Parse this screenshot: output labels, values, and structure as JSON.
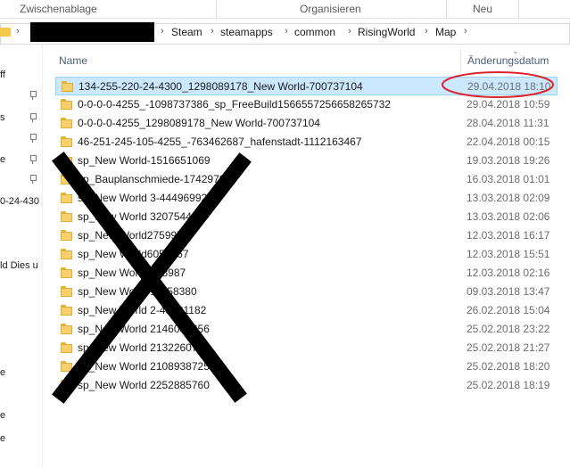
{
  "ribbon": {
    "groups": [
      "Zwischenablage",
      "Organisieren",
      "Neu"
    ]
  },
  "address": {
    "path": [
      "Steam",
      "steamapps",
      "common",
      "RisingWorld",
      "Map"
    ]
  },
  "nav": {
    "fragments": [
      "ff",
      "s",
      "e",
      "0-24-430",
      "ld Dies u",
      "e",
      "e",
      "e"
    ]
  },
  "columns": {
    "name": "Name",
    "date": "Änderungsdatum"
  },
  "files": [
    {
      "name": "134-255-220-24-4300_1298089178_New World-700737104",
      "date": "29.04.2018 18:10"
    },
    {
      "name": "0-0-0-0-4255_-1098737386_sp_FreeBuild1566557256658265732",
      "date": "29.04.2018 10:59"
    },
    {
      "name": "0-0-0-0-4255_1298089178_New World-700737104",
      "date": "28.04.2018 11:31"
    },
    {
      "name": "46-251-245-105-4255_-763462687_hafenstadt-1112163467",
      "date": "22.04.2018 00:15"
    },
    {
      "name": "sp_New World-1516651069",
      "date": "19.03.2018 19:26"
    },
    {
      "name": "sp_Bauplanschmiede-1742978",
      "date": "16.03.2018 01:01"
    },
    {
      "name": "sp_New World 3-44496992",
      "date": "13.03.2018 02:09"
    },
    {
      "name": "sp_New World 32075442",
      "date": "13.03.2018 02:06"
    },
    {
      "name": "sp_New World275997",
      "date": "12.03.2018 16:17"
    },
    {
      "name": "sp_New World6056767",
      "date": "12.03.2018 15:51"
    },
    {
      "name": "sp_New World 318987",
      "date": "12.03.2018 02:16"
    },
    {
      "name": "sp_New World 11058380",
      "date": "09.03.2018 13:47"
    },
    {
      "name": "sp_New World 2-43891182",
      "date": "26.02.2018 15:04"
    },
    {
      "name": "sp_New World 2146058656",
      "date": "25.02.2018 23:22"
    },
    {
      "name": "sp_New World 2132260711",
      "date": "25.02.2018 21:27"
    },
    {
      "name": "sp_New World 2108938725",
      "date": "25.02.2018 18:20"
    },
    {
      "name": "sp_New World 2252885760",
      "date": "25.02.2018 18:19"
    }
  ],
  "colors": {
    "selection": "#cce8ff",
    "selection_border": "#99d1ff",
    "annotation_circle": "#d9262e",
    "cross": "#000000",
    "folder": "#f6d06a"
  }
}
